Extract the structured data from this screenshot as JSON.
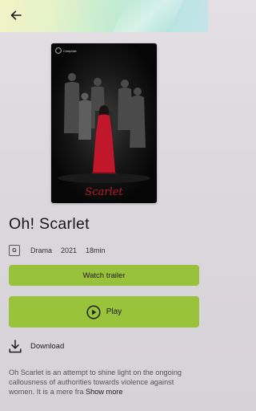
{
  "header": {
    "back_icon": "arrow-left-icon"
  },
  "poster": {
    "logo_text": "Cinéphile",
    "title_script": "Scarlet",
    "accent_color": "#c0182a"
  },
  "movie": {
    "title": "Oh! Scarlet",
    "rating": "G",
    "genre": "Drama",
    "year": "2021",
    "duration": "18min"
  },
  "actions": {
    "trailer_label": "Watch trailer",
    "play_label": "Play",
    "download_label": "Download",
    "accent_color": "#99c23c"
  },
  "description": {
    "text": "Oh Scarlet is an attempt to shine light on the ongoing callousness of authorities towards violence against women. It is a mere fra",
    "more_label": "Show more"
  }
}
